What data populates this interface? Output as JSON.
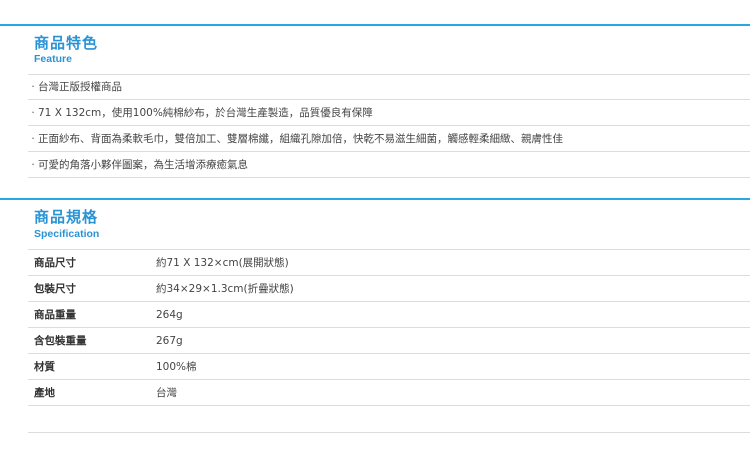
{
  "feature_section": {
    "title": "商品特色",
    "subtitle": "Feature",
    "bullet": "·",
    "items": [
      "台灣正版授權商品",
      "71 X 132cm，使用100%純棉紗布，於台灣生產製造，品質優良有保障",
      "正面紗布、背面為柔軟毛巾，雙倍加工、雙層棉纖，組織孔隙加倍，快乾不易滋生細菌，觸感輕柔細緻、親膚性佳",
      "可愛的角落小夥伴圖案，為生活增添療癒氣息"
    ]
  },
  "spec_section": {
    "title": "商品規格",
    "subtitle": "Specification",
    "rows": [
      {
        "label": "商品尺寸",
        "value": "約71 X 132×cm(展開狀態)"
      },
      {
        "label": "包裝尺寸",
        "value": "約34×29×1.3cm(折疊狀態)"
      },
      {
        "label": "商品重量",
        "value": "264g"
      },
      {
        "label": "含包裝重量",
        "value": "267g"
      },
      {
        "label": "材質",
        "value": "100%棉"
      },
      {
        "label": "產地",
        "value": "台灣"
      }
    ]
  }
}
